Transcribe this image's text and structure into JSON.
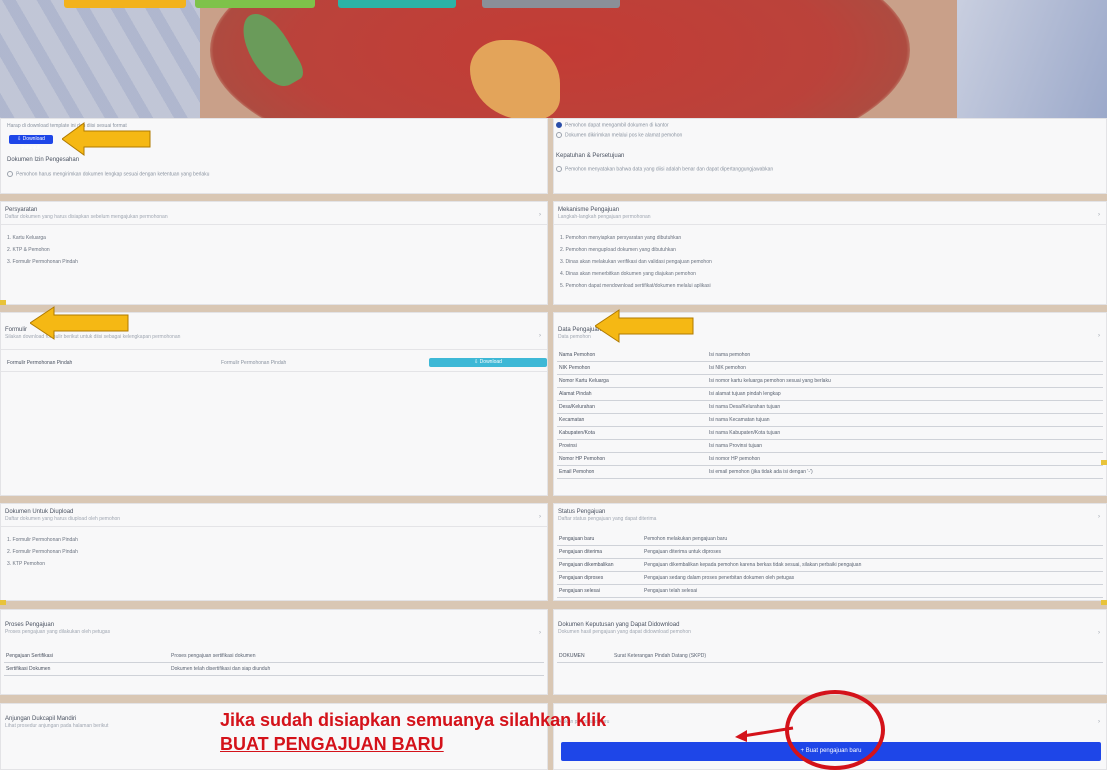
{
  "top": {
    "buttons": [
      {
        "label": "",
        "color": "#f2b21c"
      },
      {
        "label": "",
        "color": "#7ec24a"
      },
      {
        "label": "",
        "color": "#2bb3a6"
      },
      {
        "label": "",
        "color": "#8a8f98"
      }
    ]
  },
  "left_top": {
    "instruction": "Harap di download template ini dan diisi sesuai format",
    "download_label": "Download petunjuk",
    "section_title": "Dokumen Izin Pengesahan",
    "checkbox_text": "Pemohon harus mengirimkan dokumen lengkap sesuai dengan ketentuan yang berlaku"
  },
  "right_top": {
    "radio1": "Pemohon dapat mengambil dokumen di kantor",
    "radio2": "Dokumen dikirimkan melalui pos ke alamat pemohon",
    "section_title": "Kepatuhan & Persetujuan",
    "checkbox_text": "Pemohon menyatakan bahwa data yang diisi adalah benar dan dapat dipertanggungjawabkan"
  },
  "persyaratan": {
    "title": "Persyaratan",
    "subtitle": "Daftar dokumen yang harus disiapkan sebelum mengajukan permohonan",
    "items": [
      "1.  Kartu Keluarga",
      "2.  KTP & Pemohon",
      "3.  Formulir Permohonan Pindah"
    ]
  },
  "mekanisme": {
    "title": "Mekanisme Pengajuan",
    "subtitle": "Langkah-langkah pengajuan permohonan",
    "items": [
      "1.  Pemohon menyiapkan persyaratan yang dibutuhkan",
      "2.  Pemohon mengupload dokumen yang dibutuhkan",
      "3.  Dinas akan melakukan verifikasi dan validasi pengajuan pemohon",
      "4.  Dinas akan menerbitkan dokumen yang diajukan pemohon",
      "5.  Pemohon dapat mendownload sertifikat/dokumen melalui aplikasi"
    ]
  },
  "formulir": {
    "title": "Formulir",
    "subtitle": "Silakan download formulir berikut untuk diisi sebagai kelengkapan permohonan",
    "row_label": "Formulir Permohonan Pindah",
    "row_value": "Formulir Permohonan Pindah",
    "download_label": "Download"
  },
  "data_pengajuan": {
    "title": "Data Pengajuan",
    "subtitle": "Data pemohon",
    "rows": [
      {
        "k": "Nama Pemohon",
        "v": "Isi nama pemohon"
      },
      {
        "k": "NIK Pemohon",
        "v": "Isi NIK pemohon"
      },
      {
        "k": "Nomor Kartu Keluarga",
        "v": "Isi nomor kartu keluarga pemohon sesuai yang berlaku"
      },
      {
        "k": "Alamat Pindah",
        "v": "Isi alamat tujuan pindah lengkap"
      },
      {
        "k": "Desa/Kelurahan",
        "v": "Isi nama Desa/Kelurahan tujuan"
      },
      {
        "k": "Kecamatan",
        "v": "Isi nama Kecamatan tujuan"
      },
      {
        "k": "Kabupaten/Kota",
        "v": "Isi nama Kabupaten/Kota tujuan"
      },
      {
        "k": "Provinsi",
        "v": "Isi nama Provinsi tujuan"
      },
      {
        "k": "Nomor HP Pemohon",
        "v": "Isi nomor HP pemohon"
      },
      {
        "k": "Email Pemohon",
        "v": "Isi email pemohon (jika tidak ada isi dengan '-')"
      }
    ]
  },
  "dokumen_unggah": {
    "title": "Dokumen Untuk Diupload",
    "subtitle": "Daftar dokumen yang harus diupload oleh pemohon",
    "items": [
      "1.  Formulir Permohonan Pindah",
      "2.  Formulir Permohonan Pindah",
      "3.  KTP Pemohon"
    ]
  },
  "status_pengajuan": {
    "title": "Status Pengajuan",
    "subtitle": "Daftar status pengajuan yang dapat diterima",
    "rows": [
      {
        "k": "Pengajuan baru",
        "v": "Pemohon melakukan pengajuan baru"
      },
      {
        "k": "Pengajuan diterima",
        "v": "Pengajuan diterima untuk diproses"
      },
      {
        "k": "Pengajuan dikembalikan",
        "v": "Pengajuan dikembalikan kepada pemohon karena berkas tidak sesuai, silakan perbaiki pengajuan"
      },
      {
        "k": "Pengajuan diproses",
        "v": "Pengajuan sedang dalam proses penerbitan dokumen oleh petugas"
      },
      {
        "k": "Pengajuan selesai",
        "v": "Pengajuan telah selesai"
      }
    ]
  },
  "proses_pengajuan": {
    "title": "Proses Pengajuan",
    "subtitle": "Proses pengajuan yang dilakukan oleh petugas",
    "rows": [
      {
        "k": "Pengajuan Sertifikasi",
        "v": "Proses pengajuan sertifikasi dokumen"
      },
      {
        "k": "Sertifikasi Dokumen",
        "v": "Dokumen telah disertifikasi dan siap diunduh"
      }
    ]
  },
  "dokumen_download": {
    "title": "Dokumen Keputusan yang Dapat Didownload",
    "subtitle": "Dokumen hasil pengajuan yang dapat didownload pemohon",
    "row_k": "DOKUMEN",
    "row_v": "Surat Keterangan Pindah Datang (SKPD)"
  },
  "anjungan": {
    "title": "Anjungan Dukcapil Mandiri",
    "subtitle": "Lihat prosedur anjungan pada halaman berikut"
  },
  "buat_baru": {
    "hint": "Ajukan pengajuan baru",
    "button_label": "Buat pengajuan baru"
  },
  "annotation": {
    "line1": "Jika sudah disiapkan semuanya silahkan klik",
    "line2": "BUAT PENGAJUAN BARU"
  }
}
